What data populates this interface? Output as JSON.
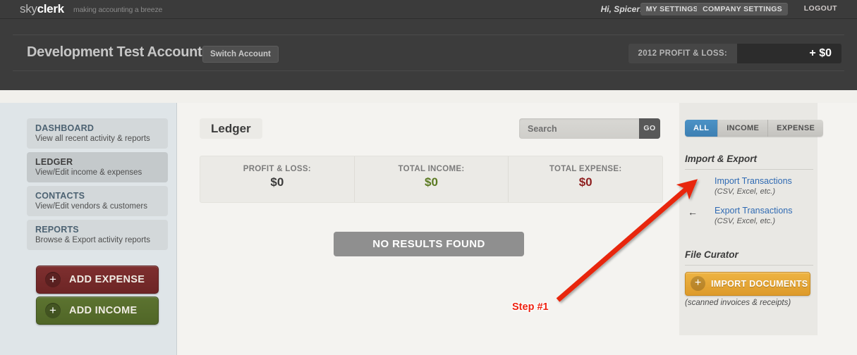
{
  "topbar": {
    "logo_sky": "sky",
    "logo_clerk": "clerk",
    "tagline": "making accounting a breeze",
    "greeting": "Hi, Spicer!",
    "my_settings": "MY SETTINGS",
    "company_settings": "COMPANY SETTINGS",
    "logout": "LOGOUT"
  },
  "account_header": {
    "account_name": "Development Test Account",
    "switch_account": "Switch Account",
    "profit_loss_label": "2012 PROFIT & LOSS:",
    "profit_loss_value": "+ $0"
  },
  "sidebar": {
    "items": [
      {
        "title": "DASHBOARD",
        "subtitle": "View all recent activity & reports",
        "active": false
      },
      {
        "title": "LEDGER",
        "subtitle": "View/Edit income & expenses",
        "active": true
      },
      {
        "title": "CONTACTS",
        "subtitle": "View/Edit vendors & customers",
        "active": false
      },
      {
        "title": "REPORTS",
        "subtitle": "Browse & Export activity reports",
        "active": false
      }
    ],
    "add_expense": "ADD EXPENSE",
    "add_income": "ADD INCOME",
    "plus_glyph": "+"
  },
  "main": {
    "page_title": "Ledger",
    "search_placeholder": "Search",
    "search_value": "",
    "go_label": "GO",
    "stats": [
      {
        "label": "PROFIT & LOSS:",
        "value": "$0",
        "color": "#3b3b3b"
      },
      {
        "label": "TOTAL INCOME:",
        "value": "$0",
        "color": "#5b7a22"
      },
      {
        "label": "TOTAL EXPENSE:",
        "value": "$0",
        "color": "#8e1f1f"
      }
    ],
    "no_results": "NO RESULTS FOUND"
  },
  "right_panel": {
    "filter_tabs": [
      {
        "label": "ALL",
        "active": true
      },
      {
        "label": "INCOME",
        "active": false
      },
      {
        "label": "EXPENSE",
        "active": false
      }
    ],
    "import_export_heading": "Import & Export",
    "links": [
      {
        "arrow": "→",
        "label": "Import Transactions",
        "sub": "(CSV, Excel, etc.)"
      },
      {
        "arrow": "←",
        "label": "Export Transactions",
        "sub": "(CSV, Excel, etc.)"
      }
    ],
    "file_curator_heading": "File Curator",
    "import_documents": "IMPORT DOCUMENTS",
    "import_documents_caption": "(scanned invoices & receipts)",
    "plus_glyph": "+"
  },
  "annotation": {
    "step_label": "Step #1",
    "arrow_color": "#e8280f"
  }
}
